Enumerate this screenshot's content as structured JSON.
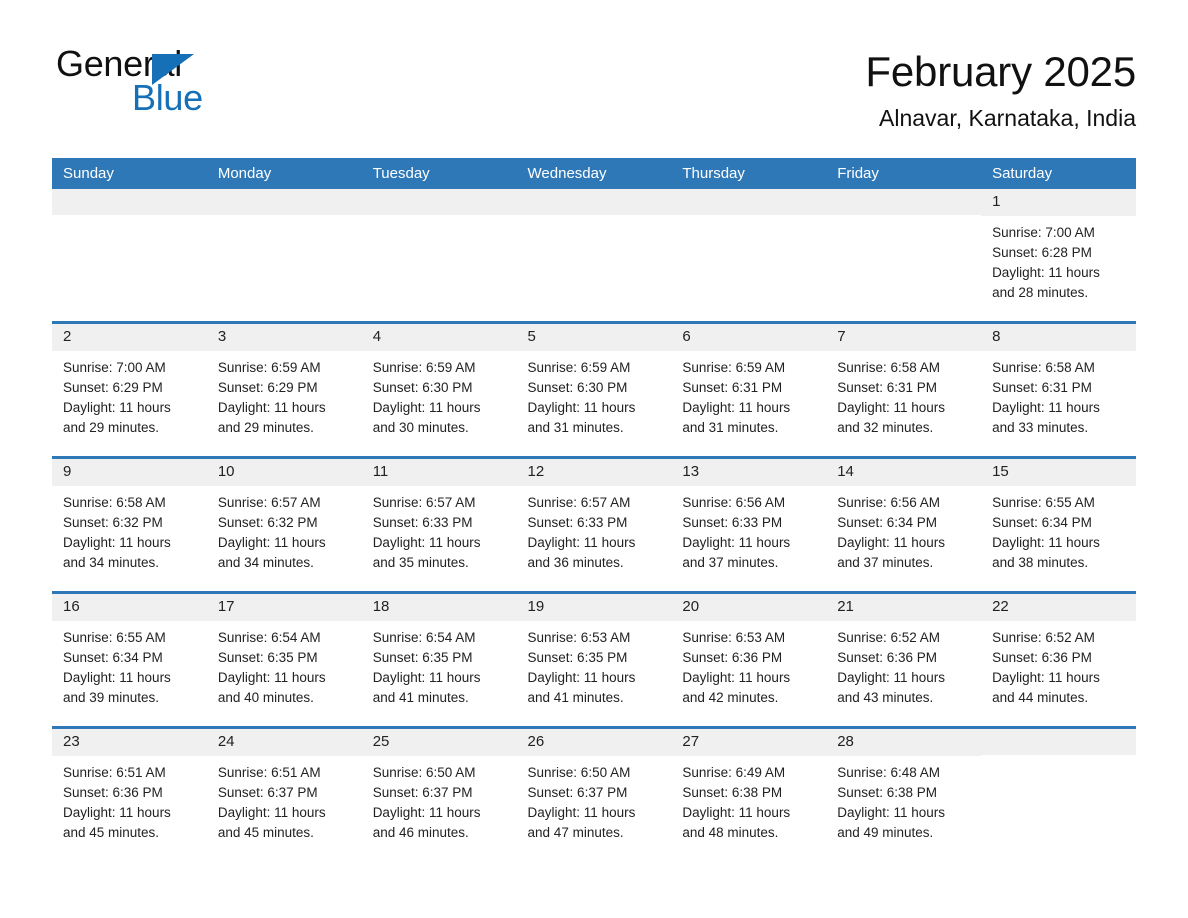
{
  "brand": {
    "name_part1": "General",
    "name_part2": "Blue",
    "primary_color": "#1570b8"
  },
  "header": {
    "title": "February 2025",
    "location": "Alnavar, Karnataka, India"
  },
  "calendar": {
    "header_color": "#2f78b8",
    "weekday_band_color": "#f0f0f0",
    "weekdays": [
      "Sunday",
      "Monday",
      "Tuesday",
      "Wednesday",
      "Thursday",
      "Friday",
      "Saturday"
    ],
    "weeks": [
      [
        {
          "day": "",
          "sunrise": "",
          "sunset": "",
          "daylight_line1": "",
          "daylight_line2": ""
        },
        {
          "day": "",
          "sunrise": "",
          "sunset": "",
          "daylight_line1": "",
          "daylight_line2": ""
        },
        {
          "day": "",
          "sunrise": "",
          "sunset": "",
          "daylight_line1": "",
          "daylight_line2": ""
        },
        {
          "day": "",
          "sunrise": "",
          "sunset": "",
          "daylight_line1": "",
          "daylight_line2": ""
        },
        {
          "day": "",
          "sunrise": "",
          "sunset": "",
          "daylight_line1": "",
          "daylight_line2": ""
        },
        {
          "day": "",
          "sunrise": "",
          "sunset": "",
          "daylight_line1": "",
          "daylight_line2": ""
        },
        {
          "day": "1",
          "sunrise": "Sunrise: 7:00 AM",
          "sunset": "Sunset: 6:28 PM",
          "daylight_line1": "Daylight: 11 hours",
          "daylight_line2": "and 28 minutes."
        }
      ],
      [
        {
          "day": "2",
          "sunrise": "Sunrise: 7:00 AM",
          "sunset": "Sunset: 6:29 PM",
          "daylight_line1": "Daylight: 11 hours",
          "daylight_line2": "and 29 minutes."
        },
        {
          "day": "3",
          "sunrise": "Sunrise: 6:59 AM",
          "sunset": "Sunset: 6:29 PM",
          "daylight_line1": "Daylight: 11 hours",
          "daylight_line2": "and 29 minutes."
        },
        {
          "day": "4",
          "sunrise": "Sunrise: 6:59 AM",
          "sunset": "Sunset: 6:30 PM",
          "daylight_line1": "Daylight: 11 hours",
          "daylight_line2": "and 30 minutes."
        },
        {
          "day": "5",
          "sunrise": "Sunrise: 6:59 AM",
          "sunset": "Sunset: 6:30 PM",
          "daylight_line1": "Daylight: 11 hours",
          "daylight_line2": "and 31 minutes."
        },
        {
          "day": "6",
          "sunrise": "Sunrise: 6:59 AM",
          "sunset": "Sunset: 6:31 PM",
          "daylight_line1": "Daylight: 11 hours",
          "daylight_line2": "and 31 minutes."
        },
        {
          "day": "7",
          "sunrise": "Sunrise: 6:58 AM",
          "sunset": "Sunset: 6:31 PM",
          "daylight_line1": "Daylight: 11 hours",
          "daylight_line2": "and 32 minutes."
        },
        {
          "day": "8",
          "sunrise": "Sunrise: 6:58 AM",
          "sunset": "Sunset: 6:31 PM",
          "daylight_line1": "Daylight: 11 hours",
          "daylight_line2": "and 33 minutes."
        }
      ],
      [
        {
          "day": "9",
          "sunrise": "Sunrise: 6:58 AM",
          "sunset": "Sunset: 6:32 PM",
          "daylight_line1": "Daylight: 11 hours",
          "daylight_line2": "and 34 minutes."
        },
        {
          "day": "10",
          "sunrise": "Sunrise: 6:57 AM",
          "sunset": "Sunset: 6:32 PM",
          "daylight_line1": "Daylight: 11 hours",
          "daylight_line2": "and 34 minutes."
        },
        {
          "day": "11",
          "sunrise": "Sunrise: 6:57 AM",
          "sunset": "Sunset: 6:33 PM",
          "daylight_line1": "Daylight: 11 hours",
          "daylight_line2": "and 35 minutes."
        },
        {
          "day": "12",
          "sunrise": "Sunrise: 6:57 AM",
          "sunset": "Sunset: 6:33 PM",
          "daylight_line1": "Daylight: 11 hours",
          "daylight_line2": "and 36 minutes."
        },
        {
          "day": "13",
          "sunrise": "Sunrise: 6:56 AM",
          "sunset": "Sunset: 6:33 PM",
          "daylight_line1": "Daylight: 11 hours",
          "daylight_line2": "and 37 minutes."
        },
        {
          "day": "14",
          "sunrise": "Sunrise: 6:56 AM",
          "sunset": "Sunset: 6:34 PM",
          "daylight_line1": "Daylight: 11 hours",
          "daylight_line2": "and 37 minutes."
        },
        {
          "day": "15",
          "sunrise": "Sunrise: 6:55 AM",
          "sunset": "Sunset: 6:34 PM",
          "daylight_line1": "Daylight: 11 hours",
          "daylight_line2": "and 38 minutes."
        }
      ],
      [
        {
          "day": "16",
          "sunrise": "Sunrise: 6:55 AM",
          "sunset": "Sunset: 6:34 PM",
          "daylight_line1": "Daylight: 11 hours",
          "daylight_line2": "and 39 minutes."
        },
        {
          "day": "17",
          "sunrise": "Sunrise: 6:54 AM",
          "sunset": "Sunset: 6:35 PM",
          "daylight_line1": "Daylight: 11 hours",
          "daylight_line2": "and 40 minutes."
        },
        {
          "day": "18",
          "sunrise": "Sunrise: 6:54 AM",
          "sunset": "Sunset: 6:35 PM",
          "daylight_line1": "Daylight: 11 hours",
          "daylight_line2": "and 41 minutes."
        },
        {
          "day": "19",
          "sunrise": "Sunrise: 6:53 AM",
          "sunset": "Sunset: 6:35 PM",
          "daylight_line1": "Daylight: 11 hours",
          "daylight_line2": "and 41 minutes."
        },
        {
          "day": "20",
          "sunrise": "Sunrise: 6:53 AM",
          "sunset": "Sunset: 6:36 PM",
          "daylight_line1": "Daylight: 11 hours",
          "daylight_line2": "and 42 minutes."
        },
        {
          "day": "21",
          "sunrise": "Sunrise: 6:52 AM",
          "sunset": "Sunset: 6:36 PM",
          "daylight_line1": "Daylight: 11 hours",
          "daylight_line2": "and 43 minutes."
        },
        {
          "day": "22",
          "sunrise": "Sunrise: 6:52 AM",
          "sunset": "Sunset: 6:36 PM",
          "daylight_line1": "Daylight: 11 hours",
          "daylight_line2": "and 44 minutes."
        }
      ],
      [
        {
          "day": "23",
          "sunrise": "Sunrise: 6:51 AM",
          "sunset": "Sunset: 6:36 PM",
          "daylight_line1": "Daylight: 11 hours",
          "daylight_line2": "and 45 minutes."
        },
        {
          "day": "24",
          "sunrise": "Sunrise: 6:51 AM",
          "sunset": "Sunset: 6:37 PM",
          "daylight_line1": "Daylight: 11 hours",
          "daylight_line2": "and 45 minutes."
        },
        {
          "day": "25",
          "sunrise": "Sunrise: 6:50 AM",
          "sunset": "Sunset: 6:37 PM",
          "daylight_line1": "Daylight: 11 hours",
          "daylight_line2": "and 46 minutes."
        },
        {
          "day": "26",
          "sunrise": "Sunrise: 6:50 AM",
          "sunset": "Sunset: 6:37 PM",
          "daylight_line1": "Daylight: 11 hours",
          "daylight_line2": "and 47 minutes."
        },
        {
          "day": "27",
          "sunrise": "Sunrise: 6:49 AM",
          "sunset": "Sunset: 6:38 PM",
          "daylight_line1": "Daylight: 11 hours",
          "daylight_line2": "and 48 minutes."
        },
        {
          "day": "28",
          "sunrise": "Sunrise: 6:48 AM",
          "sunset": "Sunset: 6:38 PM",
          "daylight_line1": "Daylight: 11 hours",
          "daylight_line2": "and 49 minutes."
        },
        {
          "day": "",
          "sunrise": "",
          "sunset": "",
          "daylight_line1": "",
          "daylight_line2": ""
        }
      ]
    ]
  }
}
